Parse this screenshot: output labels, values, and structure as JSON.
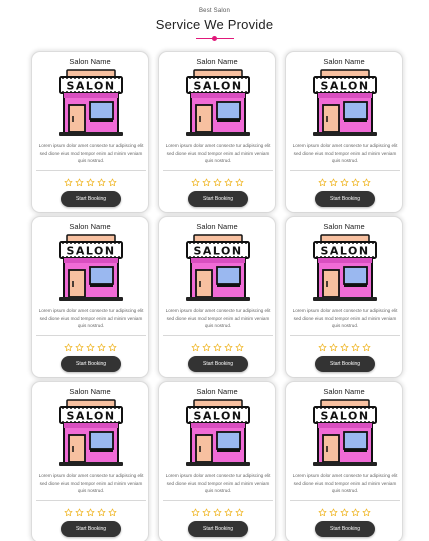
{
  "header": {
    "eyebrow": "Best Salon",
    "title": "Service We Provide"
  },
  "colors": {
    "accent": "#e0187a",
    "button": "#333333",
    "star": "#f0b82c",
    "salon_pink": "#f06bd6",
    "salon_awning": "#f7c0a0"
  },
  "card_icon": "salon-storefront-icon",
  "star_icon": "star-outline-icon",
  "cards": [
    {
      "title": "Salon Name",
      "sign": "SALON",
      "description": "Lorem ipsum dolor amet consecte tur adipiscing elit sed dione eius mod tempor enim ad minim veniam quis nostrud.",
      "rating": 0,
      "button": "Start Booking"
    },
    {
      "title": "Salon Name",
      "sign": "SALON",
      "description": "Lorem ipsum dolor amet consecte tur adipiscing elit sed dione eius mod tempor enim ad minim veniam quis nostrud.",
      "rating": 0,
      "button": "Start Booking"
    },
    {
      "title": "Salon Name",
      "sign": "SALON",
      "description": "Lorem ipsum dolor amet consecte tur adipiscing elit sed dione eius mod tempor enim ad minim veniam quis nostrud.",
      "rating": 0,
      "button": "Start Booking"
    },
    {
      "title": "Salon Name",
      "sign": "SALON",
      "description": "Lorem ipsum dolor amet consecte tur adipiscing elit sed dione eius mod tempor enim ad minim veniam quis nostrud.",
      "rating": 0,
      "button": "Start Booking"
    },
    {
      "title": "Salon Name",
      "sign": "SALON",
      "description": "Lorem ipsum dolor amet consecte tur adipiscing elit sed dione eius mod tempor enim ad minim veniam quis nostrud.",
      "rating": 0,
      "button": "Start Booking"
    },
    {
      "title": "Salon Name",
      "sign": "SALON",
      "description": "Lorem ipsum dolor amet consecte tur adipiscing elit sed dione eius mod tempor enim ad minim veniam quis nostrud.",
      "rating": 0,
      "button": "Start Booking"
    },
    {
      "title": "Salon Name",
      "sign": "SALON",
      "description": "Lorem ipsum dolor amet consecte tur adipiscing elit sed dione eius mod tempor enim ad minim veniam quis nostrud.",
      "rating": 0,
      "button": "Start Booking"
    },
    {
      "title": "Salon Name",
      "sign": "SALON",
      "description": "Lorem ipsum dolor amet consecte tur adipiscing elit sed dione eius mod tempor enim ad minim veniam quis nostrud.",
      "rating": 0,
      "button": "Start Booking"
    },
    {
      "title": "Salon Name",
      "sign": "SALON",
      "description": "Lorem ipsum dolor amet consecte tur adipiscing elit sed dione eius mod tempor enim ad minim veniam quis nostrud.",
      "rating": 0,
      "button": "Start Booking"
    }
  ]
}
